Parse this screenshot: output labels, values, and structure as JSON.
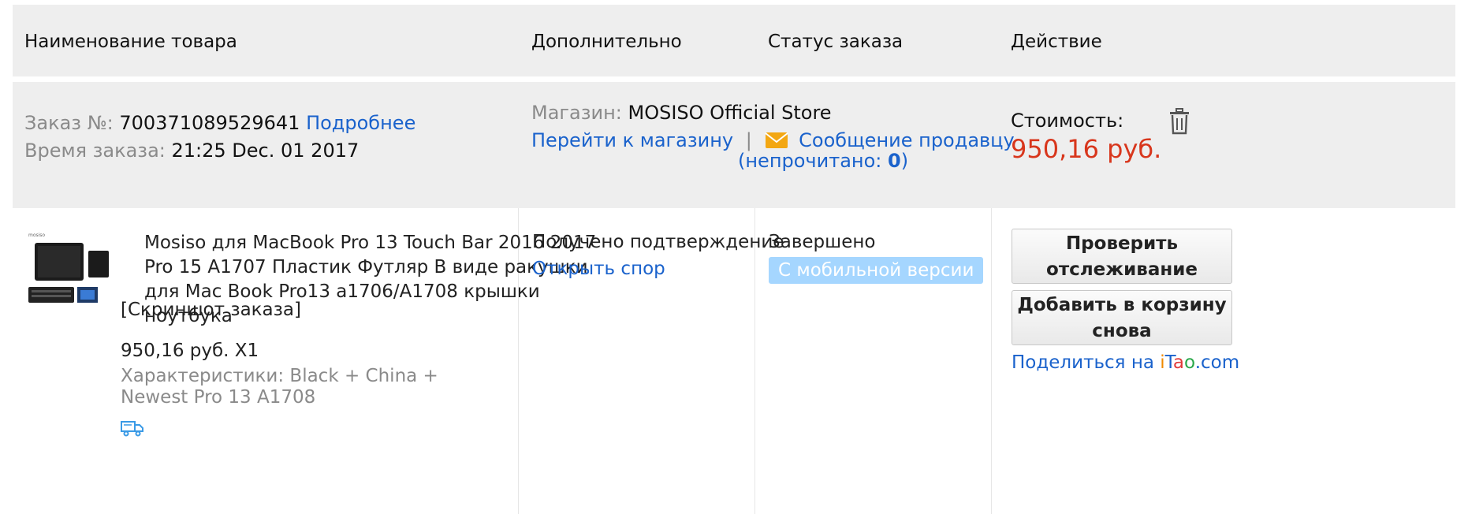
{
  "header": {
    "col_product": "Наименование товара",
    "col_extra": "Дополнительно",
    "col_status": "Статус заказа",
    "col_action": "Действие"
  },
  "order": {
    "number_label": "Заказ №:",
    "number": "700371089529641",
    "details_link": "Подробнее",
    "time_label": "Время заказа:",
    "time": "21:25 Dec. 01 2017",
    "store_label": "Магазин:",
    "store_name": "MOSISO Official Store",
    "go_to_store": "Перейти к магазину",
    "separator": "|",
    "message_seller": "Сообщение продавцу",
    "unread_prefix": "(непрочитано: ",
    "unread_count": "0",
    "unread_suffix": ")",
    "cost_label": "Стоимость:",
    "cost": "950,16 руб."
  },
  "item": {
    "title": "Mosiso для MacBook Pro 13 Touch Bar 2016 2017 Pro 15 A1707 Пластик Футляр В виде ракушки для Mac Book Pro13 a1706/A1708 крышки ноутбука",
    "screenshot_link": "[Скриншот заказа]",
    "price_qty": "950,16 руб. X1",
    "specs": "Характеристики: Black + China + Newest Pro 13 A1708",
    "shipping_icon": "truck-icon",
    "extra_status": "Получено подтверждение",
    "open_dispute": "Открыть спор",
    "order_status": "Завершено",
    "mobile_badge": "С мобильной версии",
    "track_button": "Проверить отслеживание",
    "add_to_cart_button": "Добавить в корзину снова",
    "share_prefix": "Поделиться на ",
    "share_i": "i",
    "share_t": "T",
    "share_a": "a",
    "share_o": "o",
    "share_com": ".com"
  },
  "colors": {
    "link": "#1a62cc",
    "price": "#d8361c",
    "badge": "#a5d6ff",
    "header_bg": "#eeeeee"
  }
}
